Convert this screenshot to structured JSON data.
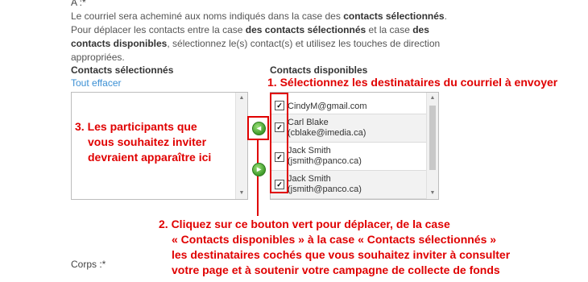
{
  "form": {
    "to_label": "A :*",
    "intro_parts": [
      "Le courriel sera acheminé aux noms indiqués dans la case des ",
      "contacts sélectionnés",
      ". Pour déplacer les contacts entre la case ",
      "des contacts sélectionnés",
      " et la case ",
      "des contacts disponibles",
      ", sélectionnez le(s) contact(s) et utilisez les touches de direction appropriées."
    ],
    "selected_heading": "Contacts sélectionnés",
    "clear_all_link": "Tout effacer",
    "available_heading": "Contacts disponibles",
    "body_label": "Corps :*"
  },
  "available_contacts": [
    {
      "line1": "CindyM@gmail.com",
      "line2": "",
      "checked": true
    },
    {
      "line1": "Carl Blake",
      "line2": "(cblake@imedia.ca)",
      "checked": true
    },
    {
      "line1": "Jack Smith",
      "line2": "(jsmith@panco.ca)",
      "checked": true
    },
    {
      "line1": "Jack Smith",
      "line2": "(jsmith@panco.ca)",
      "checked": true
    }
  ],
  "buttons": {
    "move_left_icon": "arrow-left-icon",
    "move_right_icon": "arrow-right-icon"
  },
  "annotations": {
    "step1": "1. Sélectionnez les destinataires du courriel à envoyer",
    "step2": [
      "2. Cliquez sur ce bouton vert pour déplacer, de la case",
      "« Contacts disponibles » à la case « Contacts sélectionnés »",
      "les destinataires cochés que vous souhaitez inviter à consulter",
      "votre page et à soutenir votre campagne de collecte de fonds"
    ],
    "step3": [
      "3. Les participants que",
      "vous souhaitez inviter",
      "devraient apparaître ici"
    ]
  },
  "colors": {
    "annotation": "#e00000",
    "link": "#3a8fd4",
    "button_green": "#3f9b2a"
  }
}
